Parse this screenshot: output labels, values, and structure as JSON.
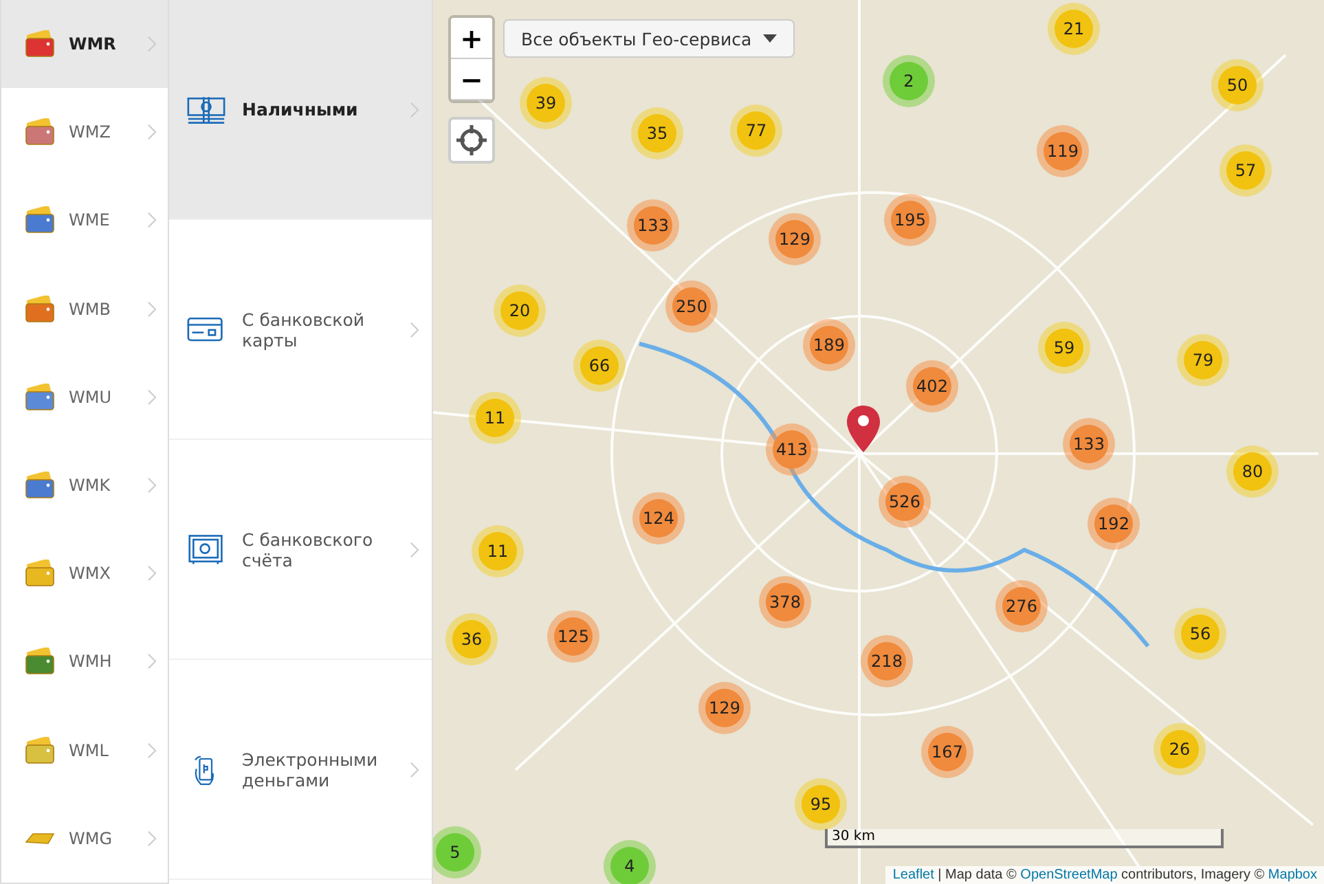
{
  "currencies": [
    {
      "label": "WMR",
      "selected": true,
      "kind": "wallet"
    },
    {
      "label": "WMZ",
      "selected": false,
      "kind": "wallet"
    },
    {
      "label": "WME",
      "selected": false,
      "kind": "wallet"
    },
    {
      "label": "WMB",
      "selected": false,
      "kind": "wallet"
    },
    {
      "label": "WMU",
      "selected": false,
      "kind": "wallet"
    },
    {
      "label": "WMK",
      "selected": false,
      "kind": "wallet"
    },
    {
      "label": "WMX",
      "selected": false,
      "kind": "wallet"
    },
    {
      "label": "WMH",
      "selected": false,
      "kind": "wallet"
    },
    {
      "label": "WML",
      "selected": false,
      "kind": "wallet"
    },
    {
      "label": "WMG",
      "selected": false,
      "kind": "bar"
    }
  ],
  "methods": [
    {
      "label": "Наличными",
      "selected": true,
      "kind": "cash"
    },
    {
      "label": "С банковской карты",
      "selected": false,
      "kind": "card"
    },
    {
      "label": "С банковского счёта",
      "selected": false,
      "kind": "safe"
    },
    {
      "label": "Электронными деньгами",
      "selected": false,
      "kind": "phone"
    }
  ],
  "map": {
    "filter": {
      "label": "Все объекты Гео-сервиса"
    },
    "zoom_in": "+",
    "zoom_out": "−",
    "clusters": [
      {
        "count": "21",
        "kind": "medium"
      },
      {
        "count": "50",
        "kind": "medium"
      },
      {
        "count": "2",
        "kind": "small"
      },
      {
        "count": "39",
        "kind": "medium"
      },
      {
        "count": "35",
        "kind": "medium"
      },
      {
        "count": "77",
        "kind": "medium"
      },
      {
        "count": "119",
        "kind": "large"
      },
      {
        "count": "57",
        "kind": "medium"
      },
      {
        "count": "133",
        "kind": "large"
      },
      {
        "count": "129",
        "kind": "large"
      },
      {
        "count": "195",
        "kind": "large"
      },
      {
        "count": "20",
        "kind": "medium"
      },
      {
        "count": "250",
        "kind": "large"
      },
      {
        "count": "189",
        "kind": "large"
      },
      {
        "count": "59",
        "kind": "medium"
      },
      {
        "count": "79",
        "kind": "medium"
      },
      {
        "count": "66",
        "kind": "medium"
      },
      {
        "count": "402",
        "kind": "large"
      },
      {
        "count": "11",
        "kind": "medium"
      },
      {
        "count": "413",
        "kind": "large"
      },
      {
        "count": "133",
        "kind": "large"
      },
      {
        "count": "80",
        "kind": "medium"
      },
      {
        "count": "526",
        "kind": "large"
      },
      {
        "count": "124",
        "kind": "large"
      },
      {
        "count": "192",
        "kind": "large"
      },
      {
        "count": "11",
        "kind": "medium"
      },
      {
        "count": "378",
        "kind": "large"
      },
      {
        "count": "276",
        "kind": "large"
      },
      {
        "count": "36",
        "kind": "medium"
      },
      {
        "count": "125",
        "kind": "large"
      },
      {
        "count": "56",
        "kind": "medium"
      },
      {
        "count": "218",
        "kind": "large"
      },
      {
        "count": "129",
        "kind": "large"
      },
      {
        "count": "167",
        "kind": "large"
      },
      {
        "count": "26",
        "kind": "medium"
      },
      {
        "count": "95",
        "kind": "medium"
      },
      {
        "count": "5",
        "kind": "small"
      },
      {
        "count": "4",
        "kind": "small"
      }
    ],
    "scale": "30 km",
    "attribution": {
      "leaflet": "Leaflet",
      "text_1": " | Map data © ",
      "osm": "OpenStreetMap",
      "text_2": " contributors, Imagery © ",
      "mapbox": "Mapbox"
    }
  }
}
